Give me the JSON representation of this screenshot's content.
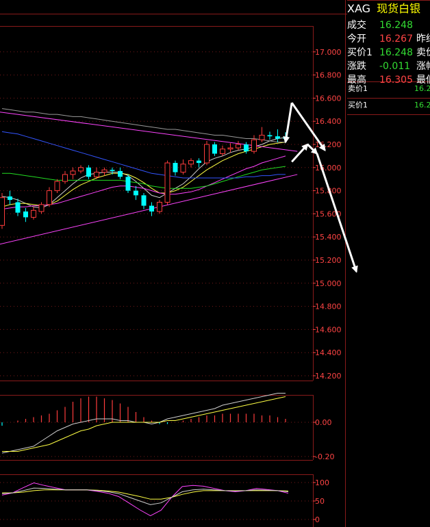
{
  "colors": {
    "up": "#ff3c3c",
    "down": "#00ffff",
    "ma_white": "#d0d0d0",
    "ma_yellow": "#ffff44",
    "ma_magenta": "#ff44ff",
    "ma_green": "#22dd22",
    "ma_blue": "#3355ff",
    "ma_gray": "#9a9a9a",
    "trendline": "#ff44ff",
    "axis_text": "#ff4444",
    "grid": "#7a1a1a",
    "arrow": "#ffffff",
    "positive": "#ff4444",
    "neutral": "#33dd33",
    "title": "#ffff00"
  },
  "symbol": {
    "code": "XAG",
    "name": "现货白银"
  },
  "quote": [
    {
      "label": "成交",
      "value": "16.248",
      "tone": "neutral",
      "label2": ""
    },
    {
      "label": "今开",
      "value": "16.267",
      "tone": "positive",
      "label2": "昨结"
    },
    {
      "label": "买价1",
      "value": "16.248",
      "tone": "neutral",
      "label2": "卖价"
    },
    {
      "label": "涨跌",
      "value": "-0.011",
      "tone": "neutral",
      "label2": "涨幅"
    },
    {
      "label": "最高",
      "value": "16.305",
      "tone": "positive",
      "label2": "最低"
    }
  ],
  "orderbook": [
    {
      "label": "卖价1",
      "value": "16.2"
    },
    {
      "label": "买价1",
      "value": "16.2"
    }
  ],
  "chart_data": [
    {
      "type": "candlestick",
      "title": "",
      "y_ticks": [
        "17.000",
        "16.800",
        "16.600",
        "16.400",
        "16.200",
        "16.000",
        "15.800",
        "15.600",
        "15.400",
        "15.200",
        "15.000",
        "14.800",
        "14.600",
        "14.400",
        "14.200"
      ],
      "ylim": [
        14.15,
        17.17
      ],
      "grid": "horizontal dotted",
      "candles": [
        [
          15.5,
          15.74,
          15.47,
          15.78
        ],
        [
          15.75,
          15.72,
          15.68,
          15.8
        ],
        [
          15.7,
          15.61,
          15.58,
          15.73
        ],
        [
          15.62,
          15.57,
          15.53,
          15.65
        ],
        [
          15.57,
          15.63,
          15.55,
          15.66
        ],
        [
          15.62,
          15.68,
          15.6,
          15.7
        ],
        [
          15.68,
          15.8,
          15.66,
          15.83
        ],
        [
          15.8,
          15.88,
          15.78,
          15.9
        ],
        [
          15.88,
          15.94,
          15.86,
          15.97
        ],
        [
          15.94,
          15.97,
          15.9,
          16.0
        ],
        [
          15.97,
          16.0,
          15.95,
          16.02
        ],
        [
          16.0,
          15.92,
          15.9,
          16.02
        ],
        [
          15.92,
          15.96,
          15.9,
          16.0
        ],
        [
          15.96,
          15.98,
          15.93,
          16.0
        ],
        [
          15.98,
          15.97,
          15.94,
          16.0
        ],
        [
          15.97,
          15.92,
          15.9,
          16.0
        ],
        [
          15.92,
          15.8,
          15.78,
          15.94
        ],
        [
          15.8,
          15.76,
          15.72,
          15.84
        ],
        [
          15.76,
          15.67,
          15.64,
          15.78
        ],
        [
          15.67,
          15.62,
          15.58,
          15.7
        ],
        [
          15.62,
          15.7,
          15.6,
          15.72
        ],
        [
          15.7,
          16.04,
          15.68,
          16.06
        ],
        [
          16.04,
          15.96,
          15.93,
          16.06
        ],
        [
          15.96,
          16.03,
          15.94,
          16.07
        ],
        [
          16.03,
          16.06,
          16.0,
          16.08
        ],
        [
          16.06,
          16.04,
          16.0,
          16.08
        ],
        [
          16.04,
          16.2,
          16.02,
          16.23
        ],
        [
          16.2,
          16.12,
          16.1,
          16.22
        ],
        [
          16.12,
          16.16,
          16.1,
          16.19
        ],
        [
          16.16,
          16.17,
          16.13,
          16.21
        ],
        [
          16.17,
          16.2,
          16.15,
          16.23
        ],
        [
          16.2,
          16.14,
          16.12,
          16.22
        ],
        [
          16.14,
          16.24,
          16.12,
          16.28
        ],
        [
          16.24,
          16.28,
          16.22,
          16.35
        ],
        [
          16.28,
          16.27,
          16.24,
          16.31
        ],
        [
          16.27,
          16.25,
          16.22,
          16.33
        ],
        [
          16.267,
          16.248,
          16.23,
          16.305
        ]
      ],
      "ma_lines": [
        {
          "color_key": "ma_white",
          "values": [
            15.75,
            15.74,
            15.72,
            15.69,
            15.66,
            15.65,
            15.68,
            15.74,
            15.8,
            15.86,
            15.91,
            15.94,
            15.95,
            15.96,
            15.96,
            15.96,
            15.93,
            15.88,
            15.82,
            15.76,
            15.74,
            15.78,
            15.82,
            15.86,
            15.92,
            15.99,
            16.05,
            16.08,
            16.1,
            16.13,
            16.15,
            16.16,
            16.18,
            16.2,
            16.23,
            16.25,
            16.26
          ]
        },
        {
          "color_key": "ma_yellow",
          "values": [
            15.66,
            15.68,
            15.69,
            15.69,
            15.68,
            15.67,
            15.68,
            15.71,
            15.76,
            15.81,
            15.85,
            15.88,
            15.91,
            15.93,
            15.95,
            15.95,
            15.94,
            15.91,
            15.87,
            15.82,
            15.78,
            15.78,
            15.8,
            15.83,
            15.88,
            15.93,
            15.98,
            16.02,
            16.06,
            16.09,
            16.12,
            16.14,
            16.16,
            16.18,
            16.2,
            16.21,
            16.22
          ]
        },
        {
          "color_key": "ma_magenta",
          "values": [
            15.64,
            15.65,
            15.66,
            15.66,
            15.67,
            15.67,
            15.68,
            15.69,
            15.71,
            15.73,
            15.75,
            15.77,
            15.79,
            15.81,
            15.83,
            15.84,
            15.84,
            15.83,
            15.82,
            15.8,
            15.78,
            15.77,
            15.77,
            15.78,
            15.79,
            15.81,
            15.84,
            15.87,
            15.9,
            15.93,
            15.96,
            15.99,
            16.01,
            16.04,
            16.06,
            16.08,
            16.1
          ]
        },
        {
          "color_key": "ma_green",
          "values": [
            15.95,
            15.95,
            15.94,
            15.93,
            15.92,
            15.91,
            15.9,
            15.89,
            15.89,
            15.89,
            15.89,
            15.89,
            15.89,
            15.89,
            15.89,
            15.89,
            15.88,
            15.87,
            15.86,
            15.84,
            15.83,
            15.82,
            15.82,
            15.82,
            15.82,
            15.83,
            15.84,
            15.86,
            15.88,
            15.9,
            15.92,
            15.94,
            15.96,
            15.98,
            15.99,
            16.0,
            16.01
          ]
        },
        {
          "color_key": "ma_blue",
          "values": [
            16.31,
            16.3,
            16.29,
            16.27,
            16.25,
            16.23,
            16.21,
            16.19,
            16.17,
            16.15,
            16.13,
            16.11,
            16.09,
            16.07,
            16.05,
            16.03,
            16.01,
            15.99,
            15.97,
            15.95,
            15.94,
            15.93,
            15.92,
            15.91,
            15.91,
            15.91,
            15.91,
            15.91,
            15.91,
            15.91,
            15.91,
            15.92,
            15.92,
            15.93,
            15.93,
            15.94,
            15.94
          ]
        },
        {
          "color_key": "ma_gray",
          "values": [
            16.51,
            16.5,
            16.49,
            16.48,
            16.48,
            16.47,
            16.46,
            16.46,
            16.45,
            16.44,
            16.44,
            16.43,
            16.42,
            16.41,
            16.4,
            16.39,
            16.38,
            16.37,
            16.36,
            16.35,
            16.34,
            16.33,
            16.33,
            16.32,
            16.31,
            16.3,
            16.29,
            16.28,
            16.28,
            16.27,
            16.26,
            16.25,
            16.25,
            16.24,
            16.23,
            16.22,
            16.22
          ]
        }
      ],
      "trendlines": [
        {
          "from": [
            -7,
            16.54
          ],
          "to": [
            37.5,
            16.14
          ]
        },
        {
          "from": [
            -7,
            15.23
          ],
          "to": [
            37.5,
            15.94
          ]
        }
      ],
      "arrows": [
        {
          "from": [
            36.8,
            16.56
          ],
          "to": [
            36.0,
            16.22
          ]
        },
        {
          "from": [
            36.8,
            16.56
          ],
          "to": [
            41.0,
            16.15
          ]
        },
        {
          "from": [
            36.8,
            16.05
          ],
          "to": [
            38.8,
            16.2
          ]
        },
        {
          "from": [
            38.8,
            16.2
          ],
          "to": [
            40.0,
            16.12
          ]
        },
        {
          "from": [
            40.0,
            16.12
          ],
          "to": [
            45.0,
            15.1
          ]
        }
      ]
    },
    {
      "type": "bar",
      "title": "",
      "y_ticks": [
        "0.00",
        "-0.20"
      ],
      "ylim": [
        -0.22,
        0.24
      ],
      "histogram": [
        -0.02,
        0.0,
        0.01,
        0.02,
        0.03,
        0.04,
        0.05,
        0.07,
        0.09,
        0.12,
        0.14,
        0.15,
        0.15,
        0.14,
        0.13,
        0.11,
        0.09,
        0.06,
        0.03,
        0.01,
        -0.01,
        -0.01,
        0.0,
        0.01,
        0.02,
        0.03,
        0.04,
        0.04,
        0.05,
        0.05,
        0.05,
        0.05,
        0.05,
        0.04,
        0.04,
        0.03,
        0.02
      ],
      "dif": [
        -0.18,
        -0.17,
        -0.16,
        -0.15,
        -0.14,
        -0.11,
        -0.08,
        -0.05,
        -0.03,
        -0.01,
        0.0,
        0.01,
        0.02,
        0.02,
        0.02,
        0.01,
        0.01,
        0.0,
        0.0,
        -0.01,
        0.0,
        0.02,
        0.03,
        0.04,
        0.05,
        0.06,
        0.07,
        0.08,
        0.1,
        0.11,
        0.12,
        0.13,
        0.14,
        0.15,
        0.16,
        0.17,
        0.17
      ],
      "dea": [
        -0.17,
        -0.17,
        -0.17,
        -0.16,
        -0.15,
        -0.14,
        -0.13,
        -0.11,
        -0.09,
        -0.07,
        -0.05,
        -0.04,
        -0.02,
        -0.01,
        0.0,
        0.0,
        0.0,
        0.0,
        0.0,
        0.0,
        0.0,
        0.01,
        0.01,
        0.02,
        0.03,
        0.04,
        0.05,
        0.06,
        0.07,
        0.08,
        0.09,
        0.1,
        0.11,
        0.12,
        0.13,
        0.14,
        0.15
      ]
    },
    {
      "type": "line",
      "title": "",
      "y_ticks": [
        "100",
        "50",
        "0"
      ],
      "ylim": [
        -8,
        115
      ],
      "k": [
        70,
        72,
        78,
        85,
        84,
        82,
        80,
        80,
        80,
        78,
        75,
        70,
        60,
        50,
        40,
        45,
        60,
        75,
        80,
        82,
        80,
        78,
        77,
        78,
        80,
        79,
        78,
        75
      ],
      "d": [
        72,
        72,
        74,
        78,
        80,
        80,
        80,
        80,
        80,
        79,
        77,
        74,
        68,
        62,
        55,
        55,
        60,
        68,
        74,
        78,
        78,
        78,
        78,
        78,
        78,
        78,
        78,
        77
      ],
      "j": [
        66,
        72,
        86,
        99,
        92,
        86,
        80,
        80,
        80,
        76,
        71,
        62,
        44,
        26,
        10,
        25,
        60,
        89,
        92,
        90,
        84,
        78,
        75,
        78,
        84,
        81,
        78,
        71
      ]
    }
  ]
}
